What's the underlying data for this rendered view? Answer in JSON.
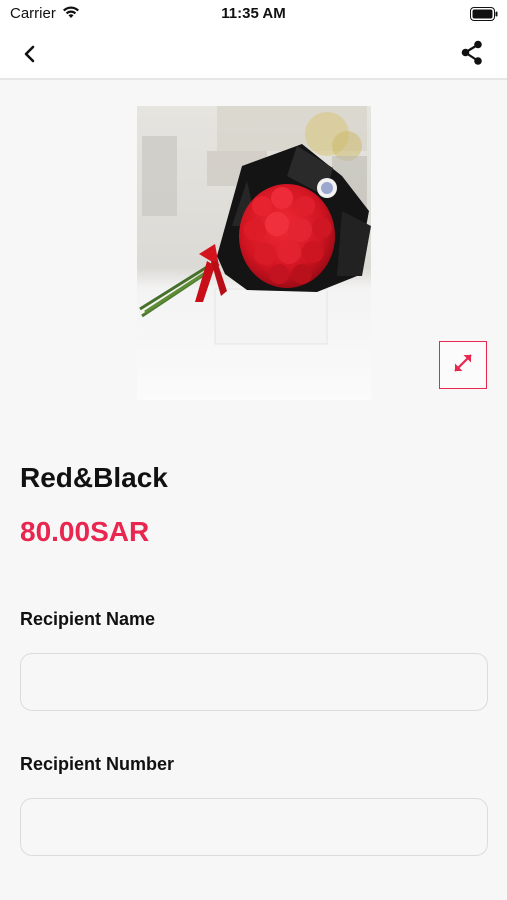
{
  "status_bar": {
    "carrier": "Carrier",
    "time": "11:35 AM"
  },
  "nav": {
    "back_icon": "chevron-left-icon",
    "share_icon": "share-icon"
  },
  "product": {
    "name": "Red&Black",
    "price": "80.00SAR",
    "image_alt": "bouquet of red roses wrapped in black paper",
    "expand_icon": "expand-arrows-icon"
  },
  "form": {
    "recipient_name_label": "Recipient Name",
    "recipient_name_value": "",
    "recipient_number_label": "Recipient Number",
    "recipient_number_value": ""
  },
  "colors": {
    "accent": "#e8264f",
    "background": "#f7f7f7"
  }
}
